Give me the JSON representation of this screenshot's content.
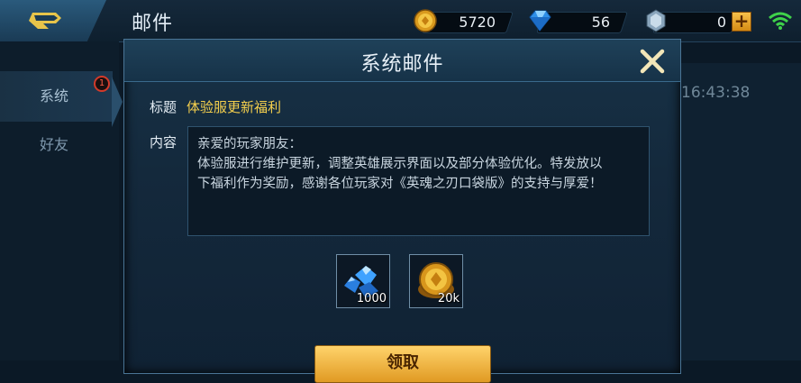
{
  "header": {
    "title": "邮件",
    "resources": [
      {
        "name": "gold",
        "value": "5720",
        "icon": "gold-coin-icon",
        "color": "#f2b93a"
      },
      {
        "name": "diamond",
        "value": "56",
        "icon": "blue-diamond-icon",
        "color": "#3fa7ff"
      },
      {
        "name": "crystal",
        "value": "0",
        "icon": "crystal-icon",
        "color": "#9fb7cc"
      }
    ],
    "plus_label": "+"
  },
  "sidebar": {
    "tabs": [
      {
        "label": "系统",
        "active": true,
        "badge": "1"
      },
      {
        "label": "好友",
        "active": false
      }
    ]
  },
  "background": {
    "time": "16:43:38"
  },
  "modal": {
    "title": "系统邮件",
    "subject_label": "标题",
    "subject": "体验服更新福利",
    "content_label": "内容",
    "content_lines": [
      "亲爱的玩家朋友：",
      "体验服进行维护更新，调整英雄展示界面以及部分体验优化。特发放以",
      "下福利作为奖励，感谢各位玩家对《英魂之刃口袋版》的支持与厚爱！"
    ],
    "rewards": [
      {
        "name": "diamonds",
        "amount": "1000",
        "icon": "diamond-pile-icon"
      },
      {
        "name": "gold",
        "amount": "20k",
        "icon": "gold-coin-icon"
      }
    ],
    "claim_label": "领取"
  },
  "colors": {
    "accent_gold": "#f4cf4d",
    "panel_border": "#4a7596"
  }
}
